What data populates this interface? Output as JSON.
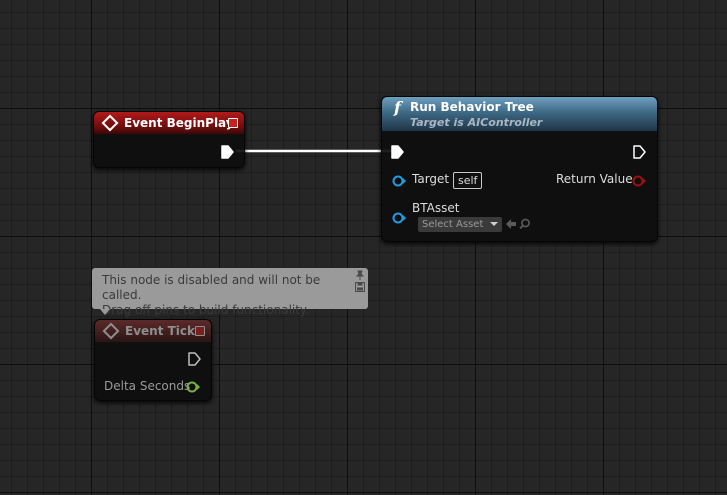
{
  "event_beginplay": {
    "title": "Event BeginPlay"
  },
  "run_behavior_tree": {
    "title": "Run Behavior Tree",
    "subtitle": "Target is AIController",
    "icon": "function-icon",
    "pins": {
      "target_label": "Target",
      "target_value": "self",
      "return_label": "Return Value",
      "btasset_label": "BTAsset",
      "btasset_value": "Select Asset"
    }
  },
  "event_tick": {
    "title": "Event Tick",
    "delta_label": "Delta Seconds",
    "tooltip_line1": "This node is disabled and will not be called.",
    "tooltip_line2": "Drag off pins to build functionality."
  },
  "colors": {
    "event_red": "#b21a1a",
    "function_blue": "#3e6985",
    "object_pin_blue": "#1e9de3",
    "bool_pin_red": "#9a1010",
    "float_pin_green": "#78b046",
    "wire": "#ffffff"
  }
}
